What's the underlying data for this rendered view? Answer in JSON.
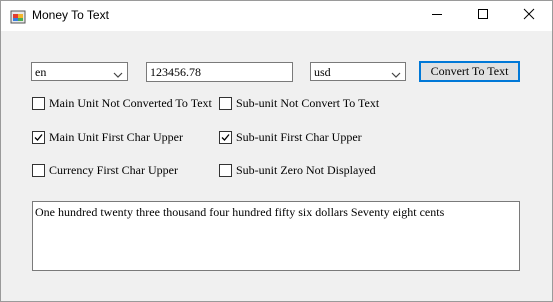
{
  "window": {
    "title": "Money To Text",
    "icons": {
      "app": "app-icon",
      "minimize": "minimize-icon",
      "maximize": "maximize-icon",
      "close": "close-icon"
    }
  },
  "form": {
    "language_select": {
      "value": "en"
    },
    "amount_input": {
      "value": "123456.78"
    },
    "currency_select": {
      "value": "usd"
    },
    "convert_button": {
      "label": "Convert To Text"
    },
    "options": [
      {
        "label": "Main Unit Not Converted To Text",
        "checked": false
      },
      {
        "label": "Sub-unit Not Convert To Text",
        "checked": false
      },
      {
        "label": "Main Unit First Char Upper",
        "checked": true
      },
      {
        "label": "Sub-unit First Char Upper",
        "checked": true
      },
      {
        "label": "Currency First Char Upper",
        "checked": false
      },
      {
        "label": "Sub-unit Zero Not Displayed",
        "checked": false
      }
    ],
    "output_text": "One hundred twenty three thousand four hundred fifty six dollars Seventy eight cents"
  }
}
